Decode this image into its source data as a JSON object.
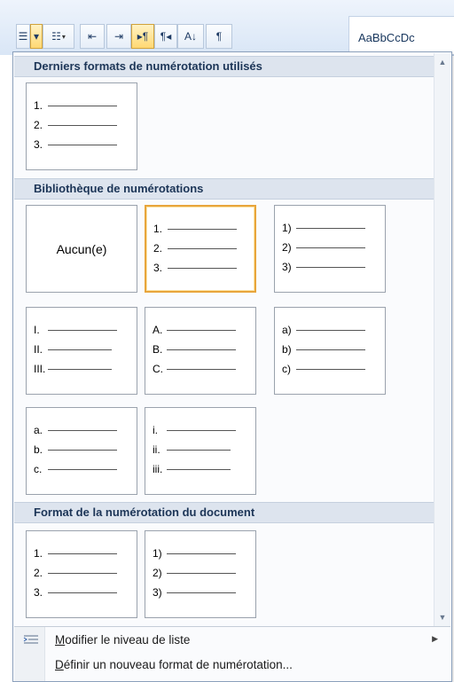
{
  "ribbon": {
    "buttons": [
      {
        "name": "numbering-icon",
        "glyph": "☰",
        "active": false,
        "dd": false
      },
      {
        "name": "numbering-dropdown-arrow",
        "glyph": "▾",
        "active": true,
        "dd": false
      },
      {
        "name": "multilevel-list-icon",
        "glyph": "☷",
        "active": false,
        "dd": true
      },
      {
        "name": "decrease-indent-icon",
        "glyph": "⇤",
        "active": false,
        "dd": false
      },
      {
        "name": "increase-indent-icon",
        "glyph": "⇥",
        "active": false,
        "dd": false
      },
      {
        "name": "ltr-text-icon",
        "glyph": "▸¶",
        "active": true,
        "dd": false
      },
      {
        "name": "rtl-text-icon",
        "glyph": "¶◂",
        "active": false,
        "dd": false
      },
      {
        "name": "sort-icon",
        "glyph": "A↓",
        "active": false,
        "dd": false
      },
      {
        "name": "show-formatting-icon",
        "glyph": "¶",
        "active": false,
        "dd": false
      }
    ],
    "style_preview": "AaBbCcDc"
  },
  "sections": {
    "recent": "Derniers formats de numérotation utilisés",
    "library": "Bibliothèque de numérotations",
    "document": "Format de la numérotation du document"
  },
  "tiles": {
    "none_label": "Aucun(e)",
    "recent": [
      [
        "1.",
        "2.",
        "3."
      ]
    ],
    "library": [
      [
        "1.",
        "2.",
        "3."
      ],
      [
        "1)",
        "2)",
        "3)"
      ],
      [
        "I.",
        "II.",
        "III."
      ],
      [
        "A.",
        "B.",
        "C."
      ],
      [
        "a)",
        "b)",
        "c)"
      ],
      [
        "a.",
        "b.",
        "c."
      ],
      [
        "i.",
        "ii.",
        "iii."
      ]
    ],
    "document": [
      [
        "1.",
        "2.",
        "3."
      ],
      [
        "1)",
        "2)",
        "3)"
      ]
    ]
  },
  "menu": {
    "change_level": {
      "accel": "M",
      "rest": "odifier le niveau de liste"
    },
    "define_new": {
      "accel": "D",
      "rest": "éfinir un nouveau format de numérotation..."
    }
  }
}
